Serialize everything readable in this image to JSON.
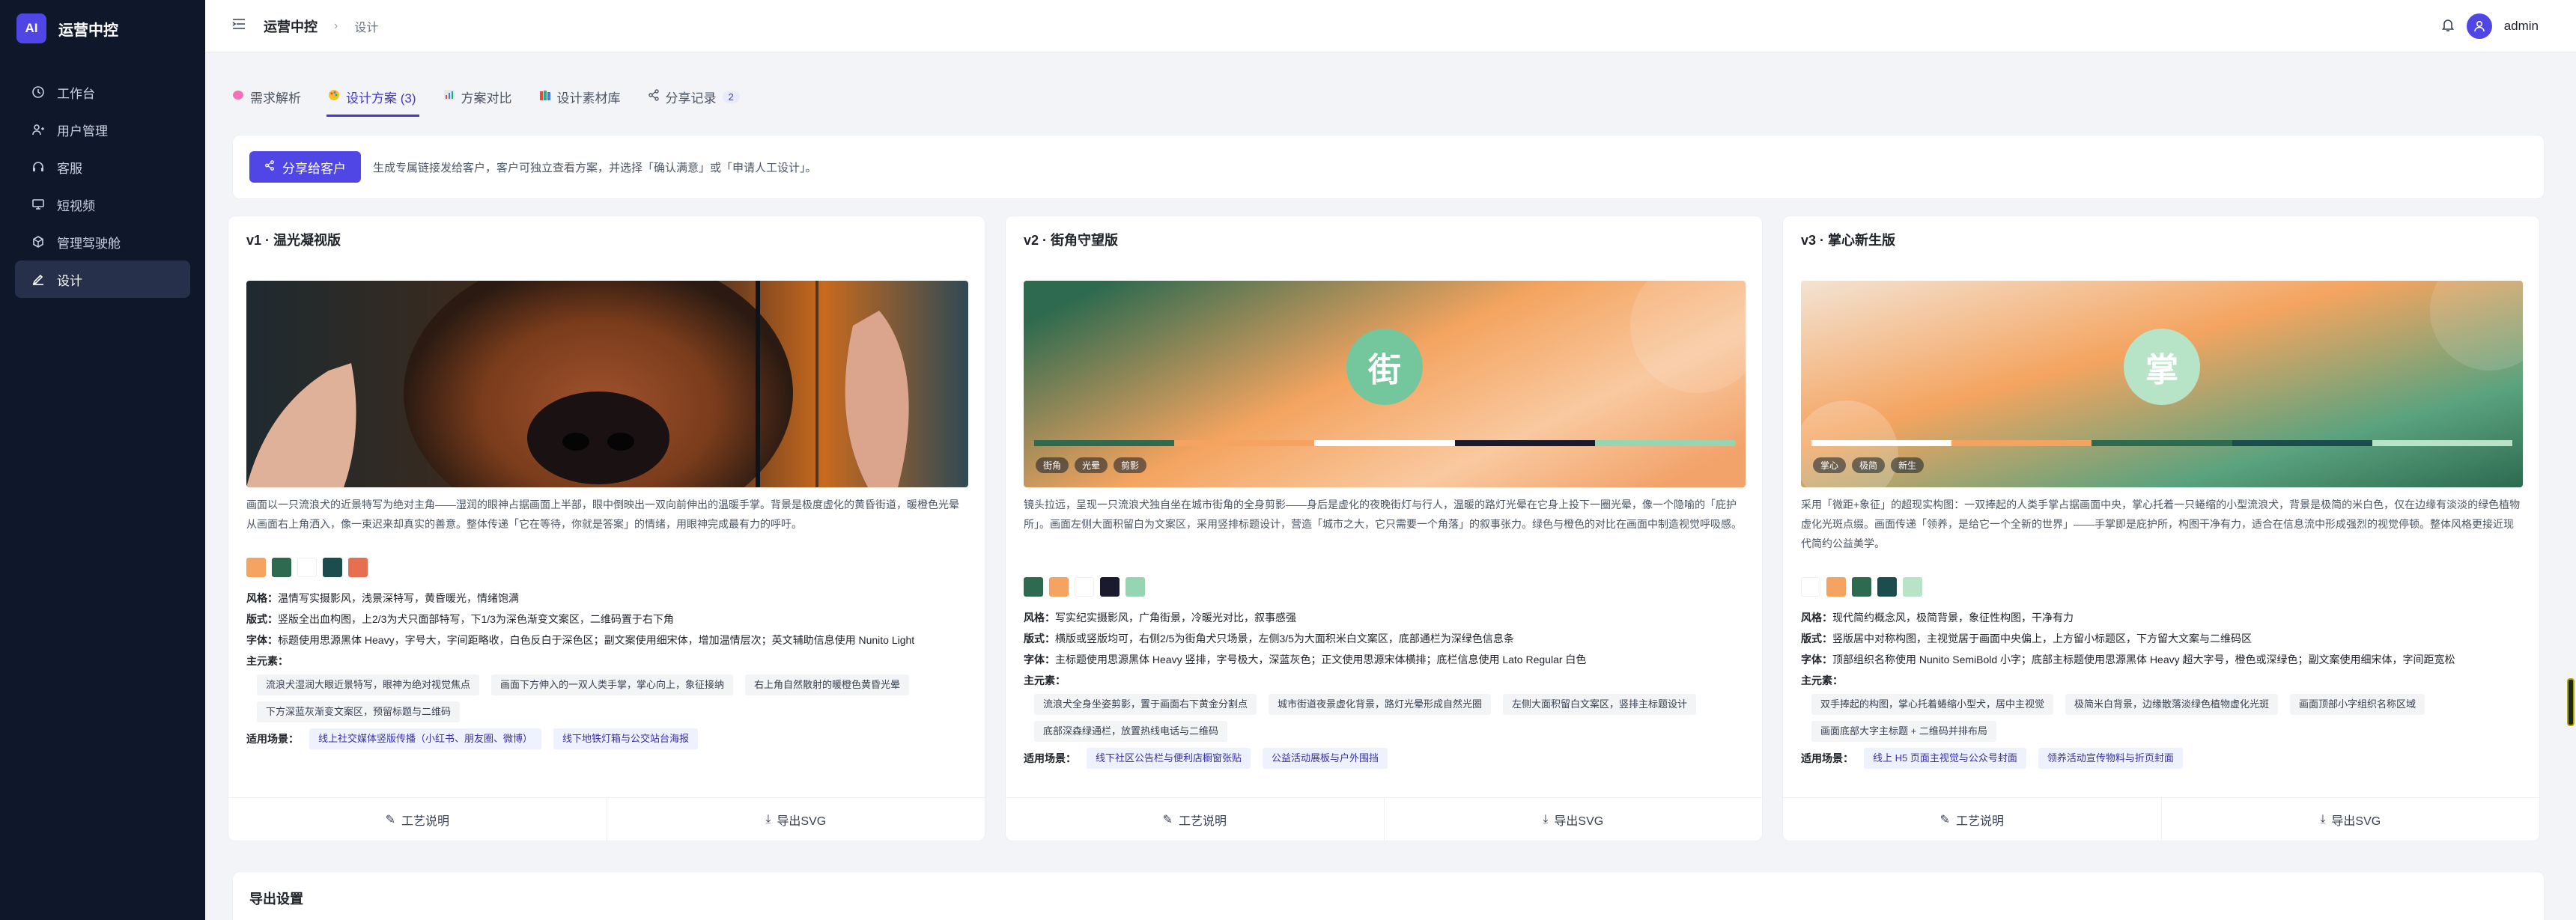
{
  "app": {
    "logo_mark": "AI",
    "name": "运营中控"
  },
  "sidebar": {
    "items": [
      {
        "label": "工作台",
        "icon": "clock-icon"
      },
      {
        "label": "用户管理",
        "icon": "user-icon"
      },
      {
        "label": "客服",
        "icon": "headset-icon"
      },
      {
        "label": "短视频",
        "icon": "monitor-icon"
      },
      {
        "label": "管理驾驶舱",
        "icon": "cube-icon"
      },
      {
        "label": "设计",
        "icon": "design-icon",
        "active": true
      }
    ]
  },
  "header": {
    "title": "运营中控",
    "sub": "设计",
    "user": "admin"
  },
  "tabs": [
    {
      "label": "需求解析",
      "icon": "brain-icon"
    },
    {
      "label": "设计方案 (3)",
      "icon": "palette-icon",
      "active": true
    },
    {
      "label": "方案对比",
      "icon": "chart-icon"
    },
    {
      "label": "设计素材库",
      "icon": "books-icon"
    },
    {
      "label": "分享记录",
      "icon": "share-icon",
      "count": "2"
    }
  ],
  "share": {
    "button": "分享给客户",
    "tip": "生成专属链接发给客户，客户可独立查看方案，并选择「确认满意」或「申请人工设计」。"
  },
  "labels": {
    "style": "风格：",
    "layout": "版式：",
    "font": "字体：",
    "elements": "主元素：",
    "scenes": "适用场景：",
    "craft": "工艺说明",
    "export": "导出SVG"
  },
  "cards": [
    {
      "title": "v1 · 温光凝视版",
      "desc": "画面以一只流浪犬的近景特写为绝对主角——湿润的眼神占据画面上半部，眼中倒映出一双向前伸出的温暖手掌。背景是极度虚化的黄昏街道，暖橙色光晕从画面右上角洒入，像一束迟来却真实的善意。整体传递「它在等待，你就是答案」的情绪，用眼神完成最有力的呼吁。",
      "colors": [
        "#f4a460",
        "#2d6a4f",
        "#ffffff",
        "#1b4d4e",
        "#e76f51"
      ],
      "style": "温情写实摄影风，浅景深特写，黄昏暖光，情绪饱满",
      "layout": "竖版全出血构图，上2/3为犬只面部特写，下1/3为深色渐变文案区，二维码置于右下角",
      "font": "标题使用思源黑体 Heavy，字号大，字间距略收，白色反白于深色区；副文案使用细宋体，增加温情层次；英文辅助信息使用 Nunito Light",
      "elements": [
        "流浪犬湿润大眼近景特写，眼神为绝对视觉焦点",
        "画面下方伸入的一双人类手掌，掌心向上，象征接纳",
        "右上角自然散射的暖橙色黄昏光晕",
        "下方深蓝灰渐变文案区，预留标题与二维码"
      ],
      "scenes": [
        "线上社交媒体竖版传播（小红书、朋友圈、微博）",
        "线下地铁灯箱与公交站台海报"
      ]
    },
    {
      "title": "v2 · 街角守望版",
      "desc": "镜头拉远，呈现一只流浪犬独自坐在城市街角的全身剪影——身后是虚化的夜晚街灯与行人，温暖的路灯光晕在它身上投下一圈光晕，像一个隐喻的「庇护所」。画面左侧大面积留白为文案区，采用竖排标题设计，营造「城市之大，它只需要一个角落」的叙事张力。绿色与橙色的对比在画面中制造视觉呼吸感。",
      "colors": [
        "#2d6a4f",
        "#f4a460",
        "#ffffff",
        "#1a1a2e",
        "#95d5b2"
      ],
      "char": "街",
      "stripe": [
        "#2d6a4f",
        "#f4a460",
        "#ffffff",
        "#1a1a2e",
        "#95d5b2"
      ],
      "pills": [
        "街角",
        "光晕",
        "剪影"
      ],
      "style": "写实纪实摄影风，广角街景，冷暖光对比，叙事感强",
      "layout": "横版或竖版均可，右侧2/5为街角犬只场景，左侧3/5为大面积米白文案区，底部通栏为深绿色信息条",
      "font": "主标题使用思源黑体 Heavy 竖排，字号极大，深蓝灰色；正文使用思源宋体横排；底栏信息使用 Lato Regular 白色",
      "elements": [
        "流浪犬全身坐姿剪影，置于画面右下黄金分割点",
        "城市街道夜景虚化背景，路灯光晕形成自然光圈",
        "左侧大面积留白文案区，竖排主标题设计",
        "底部深森绿通栏，放置热线电话与二维码"
      ],
      "scenes": [
        "线下社区公告栏与便利店橱窗张贴",
        "公益活动展板与户外围挡"
      ]
    },
    {
      "title": "v3 · 掌心新生版",
      "desc": "采用「微距+象征」的超现实构图：一双捧起的人类手掌占据画面中央，掌心托着一只蜷缩的小型流浪犬，背景是极简的米白色，仅在边缘有淡淡的绿色植物虚化光斑点缀。画面传递「领养，是给它一个全新的世界」——手掌即是庇护所，构图干净有力，适合在信息流中形成强烈的视觉停顿。整体风格更接近现代简约公益美学。",
      "colors": [
        "#ffffff",
        "#f4a460",
        "#2d6a4f",
        "#1b4d4e",
        "#b7e4c7"
      ],
      "char": "掌",
      "stripe": [
        "#ffffff",
        "#f4a460",
        "#2d6a4f",
        "#1b4d4e",
        "#b7e4c7"
      ],
      "pills": [
        "掌心",
        "极简",
        "新生"
      ],
      "style": "现代简约概念风，极简背景，象征性构图，干净有力",
      "layout": "竖版居中对称构图，主视觉居于画面中央偏上，上方留小标题区，下方留大文案与二维码区",
      "font": "顶部组织名称使用 Nunito SemiBold 小字；底部主标题使用思源黑体 Heavy 超大字号，橙色或深绿色；副文案使用细宋体，字间距宽松",
      "elements": [
        "双手捧起的构图，掌心托着蜷缩小型犬，居中主视觉",
        "极简米白背景，边缘散落淡绿色植物虚化光斑",
        "画面顶部小字组织名称区域",
        "画面底部大字主标题 + 二维码并排布局"
      ],
      "scenes": [
        "线上 H5 页面主视觉与公众号封面",
        "领养活动宣传物料与折页封面"
      ]
    }
  ],
  "export_section": {
    "title": "导出设置"
  }
}
